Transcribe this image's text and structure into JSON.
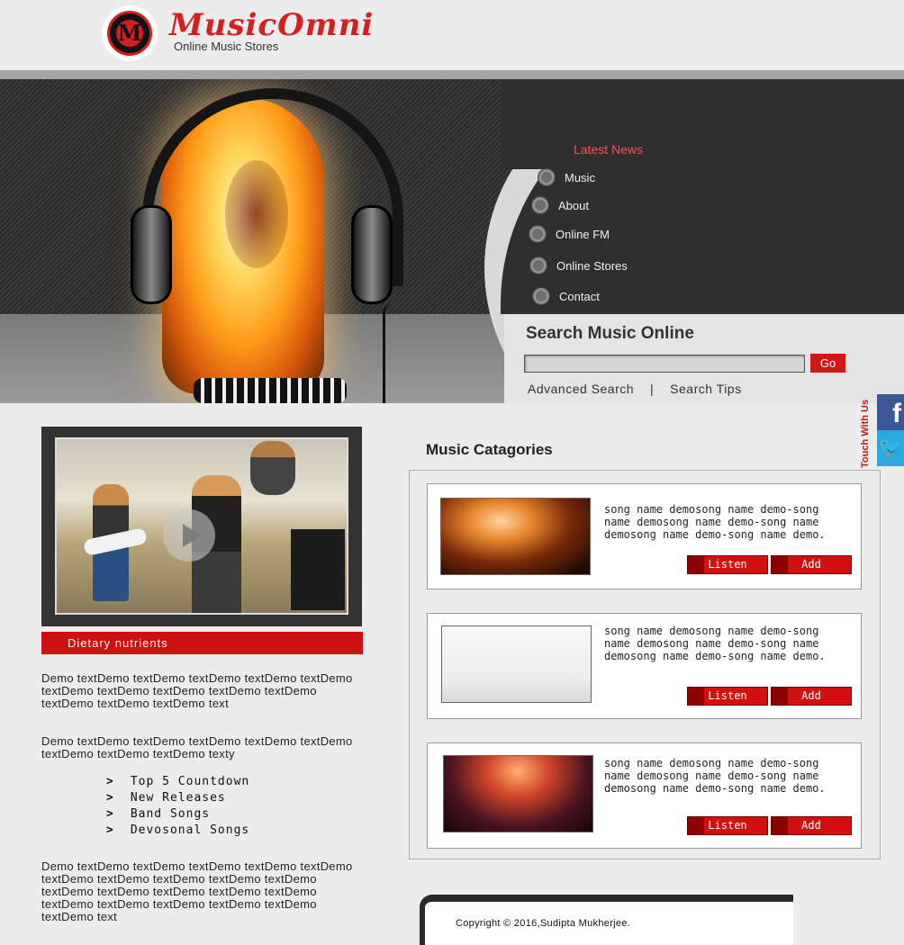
{
  "header": {
    "logo_letter": "M",
    "brand": "MusicOmni",
    "tagline": "Online Music Stores"
  },
  "news": {
    "title": "Latest News",
    "items": [
      "Music",
      "About",
      "Online FM",
      "Online Stores",
      "Contact"
    ]
  },
  "search": {
    "title": "Search Music Online",
    "input_value": "",
    "go_label": "Go",
    "advanced_label": "Advanced Search",
    "separator": "|",
    "tips_label": "Search Tips"
  },
  "social": {
    "label": "Touch With Us",
    "facebook_icon": "facebook-icon",
    "facebook_glyph": "f",
    "twitter_icon": "twitter-icon",
    "twitter_glyph": "🐦"
  },
  "featured": {
    "caption": "Dietary nutrients",
    "para1": "Demo textDemo textDemo textDemo textDemo textDemo textDemo textDemo textDemo textDemo textDemo textDemo textDemo textDemo text",
    "para2": "Demo textDemo textDemo textDemo textDemo textDemo textDemo textDemo textDemo texty",
    "list_marker": ">",
    "list": [
      "Top 5 Countdown",
      "New Releases",
      "Band Songs",
      "Devosonal Songs"
    ],
    "para3": "Demo textDemo textDemo textDemo textDemo textDemo textDemo textDemo textDemo textDemo textDemo textDemo textDemo textDemo textDemo textDemo textDemo textDemo textDemo textDemo textDemo textDemo text"
  },
  "categories": {
    "title": "Music Catagories",
    "cards": [
      {
        "text": "song name demosong name demo-song name demosong name demo-song name demosong name demo-song name demo.",
        "listen": "Listen",
        "add": "Add"
      },
      {
        "text": "song name demosong name demo-song name demosong name demo-song name demosong name demo-song name demo.",
        "listen": "Listen",
        "add": "Add"
      },
      {
        "text": "song name demosong name demo-song name demosong name demo-song name demosong name demo-song name demo.",
        "listen": "Listen",
        "add": "Add"
      }
    ]
  },
  "footer": {
    "copyright": "Copyright © 2016,Sudipta Mukherjee."
  },
  "colors": {
    "accent": "#d31616",
    "facebook": "#3b5998",
    "twitter": "#2aa9e0",
    "news_title": "#f05656"
  }
}
